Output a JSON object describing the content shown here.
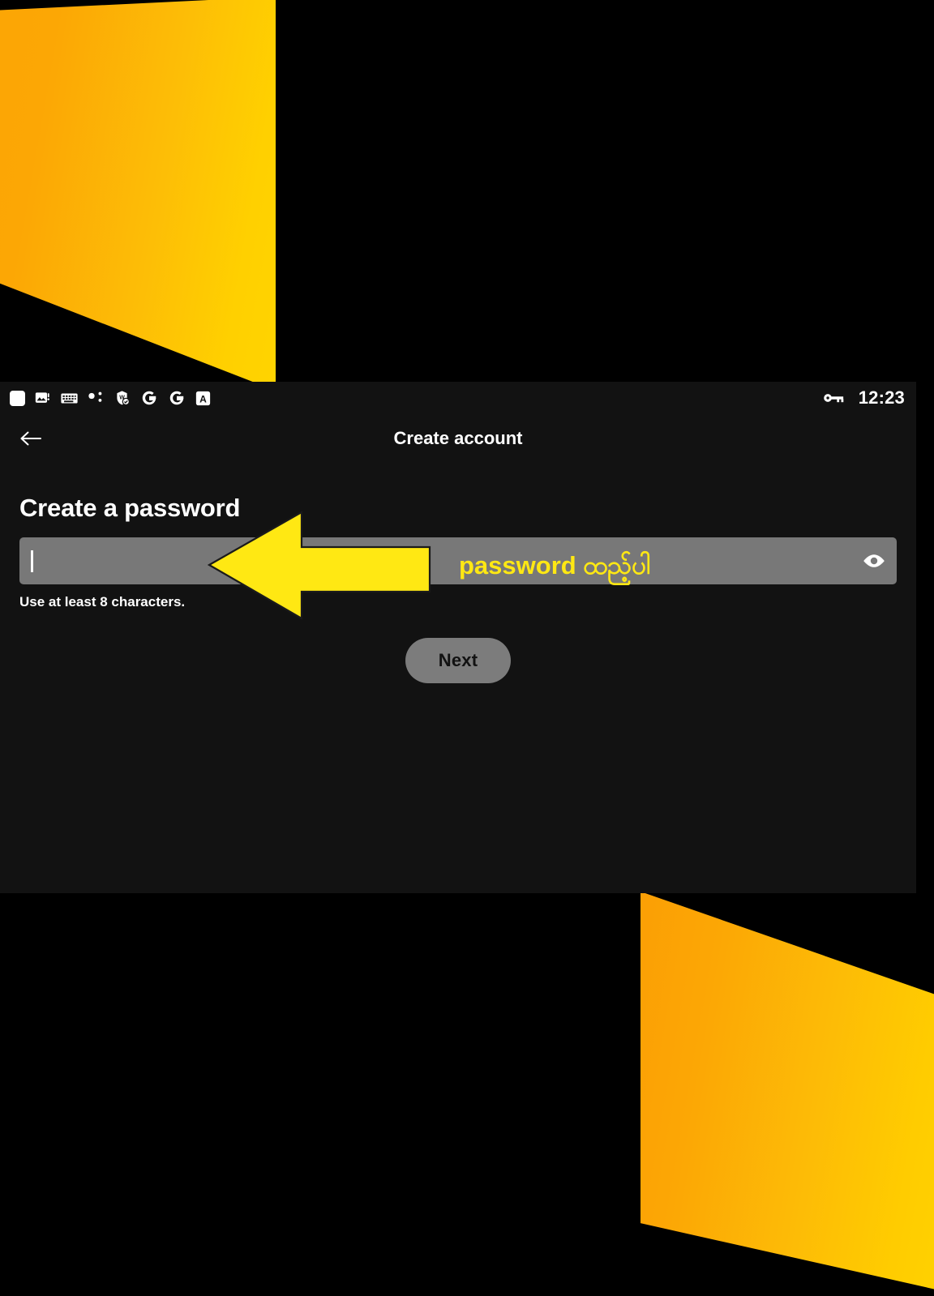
{
  "theme": {
    "panel_bg": "#121212",
    "page_bg": "#000000",
    "accent_yellow": "#FFE813",
    "gradient_start": "#FCA505",
    "gradient_end": "#FFD400",
    "field_bg": "#787878",
    "button_bg": "#7C7C7C",
    "text_primary": "#FFFFFF"
  },
  "status_bar": {
    "left_icons": [
      "rounded-square-icon",
      "image-icon",
      "keyboard-icon",
      "share-nodes-icon",
      "app-badge-icon",
      "google-icon",
      "google-icon",
      "translate-icon"
    ],
    "right_icons": [
      "vpn-key-icon"
    ],
    "clock": "12:23"
  },
  "app_bar": {
    "back_icon": "arrow-left-icon",
    "title": "Create account"
  },
  "content": {
    "heading": "Create a password",
    "password": {
      "value": "",
      "placeholder": "",
      "toggle_icon": "eye-icon",
      "helper_text": "Use at least 8 characters."
    },
    "next_label": "Next"
  },
  "annotation": {
    "arrow_icon": "arrow-left-pointer-icon",
    "arrow_color": "#FFE813",
    "label": "password ထည့်ပါ"
  }
}
